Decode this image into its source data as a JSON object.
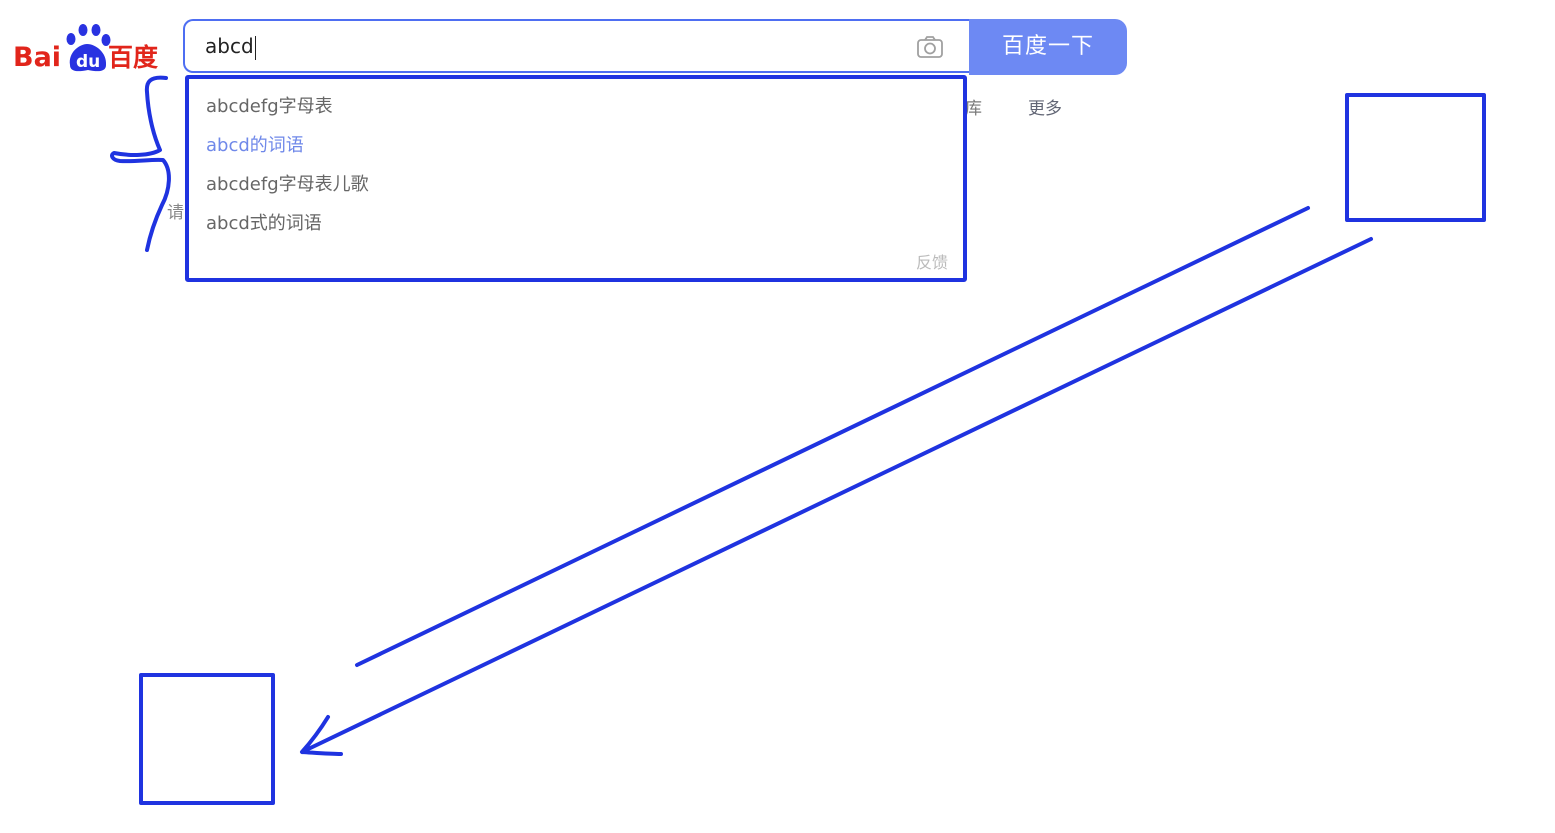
{
  "logo": {
    "text_bai": "Bai",
    "text_du": "du",
    "text_cn": "百度",
    "color_red": "#e1251b",
    "color_blue": "#2932e1"
  },
  "search": {
    "value": "abcd",
    "button_label": "百度一下",
    "camera_icon": "camera-icon",
    "accent_color": "#4e6ef2"
  },
  "nav": {
    "partial_label": "库",
    "more_label": "更多"
  },
  "background": {
    "partial_text": "请"
  },
  "suggestions": {
    "items": [
      "abcdefg字母表",
      "abcd的词语",
      "abcdefg字母表儿歌",
      "abcd式的词语"
    ],
    "active_index": 1,
    "feedback_label": "反馈"
  },
  "annotations": {
    "stroke_color": "#1f33e0",
    "shapes": [
      "brace",
      "rectangle",
      "rectangle",
      "line",
      "arrow"
    ]
  }
}
